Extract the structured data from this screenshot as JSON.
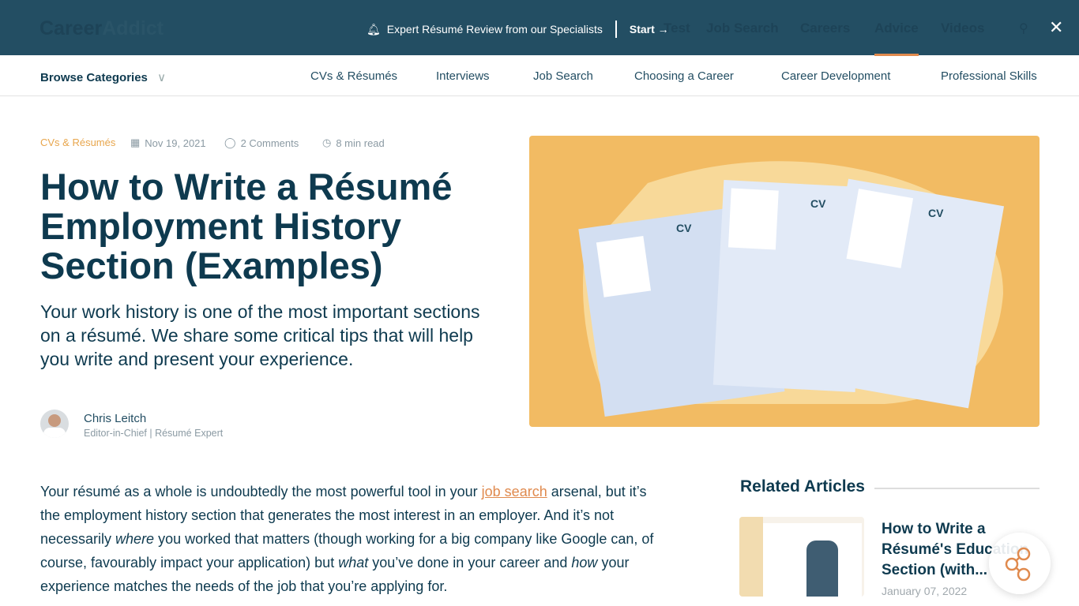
{
  "header": {
    "logo_a": "Career",
    "logo_b": "Addict",
    "faded_nav": [
      "Test",
      "Job Search",
      "Careers",
      "Advice",
      "Videos"
    ],
    "promo_text": "Expert Résumé Review from our Specialists",
    "promo_cta": "Start →",
    "close": "✕",
    "search": "⚲"
  },
  "categories": {
    "browse": "Browse Categories",
    "items": [
      "CVs & Résumés",
      "Interviews",
      "Job Search",
      "Choosing a Career",
      "Career Development",
      "Professional Skills"
    ]
  },
  "article": {
    "category": "CVs & Résumés",
    "date": "Nov 19, 2021",
    "comments": "2 Comments",
    "read_time": "8 min read",
    "title": "How to Write a Résumé Employment History Section (Examples)",
    "subtitle": "Your work history is one of the most important sections on a résumé. We share some critical tips that will help you write and present your experience.",
    "author": "Chris Leitch",
    "author_role": "Editor-in-Chief | Résumé Expert",
    "body_1": "Your résumé as a whole is undoubtedly the most powerful tool in your ",
    "body_link": "job search",
    "body_2": " arsenal, but it’s the employment history section that generates the most interest in an employer. And it’s not necessarily ",
    "body_em1": "where",
    "body_3": " you worked that matters (though working for a big company like Google can, of course, favourably impact your application) but ",
    "body_em2": "what",
    "body_4": " you’ve done in your career and ",
    "body_em3": "how",
    "body_5": " your experience matches the needs of the job that you’re applying for."
  },
  "related": {
    "title": "Related Articles",
    "items": [
      {
        "title": "How to Write a Résumé's Education Section (with...",
        "date": "January 07, 2022"
      }
    ]
  },
  "colors": {
    "header": "#234e63",
    "accent": "#e08a4e",
    "hero": "#f2bb63",
    "text": "#0e3a4f"
  }
}
